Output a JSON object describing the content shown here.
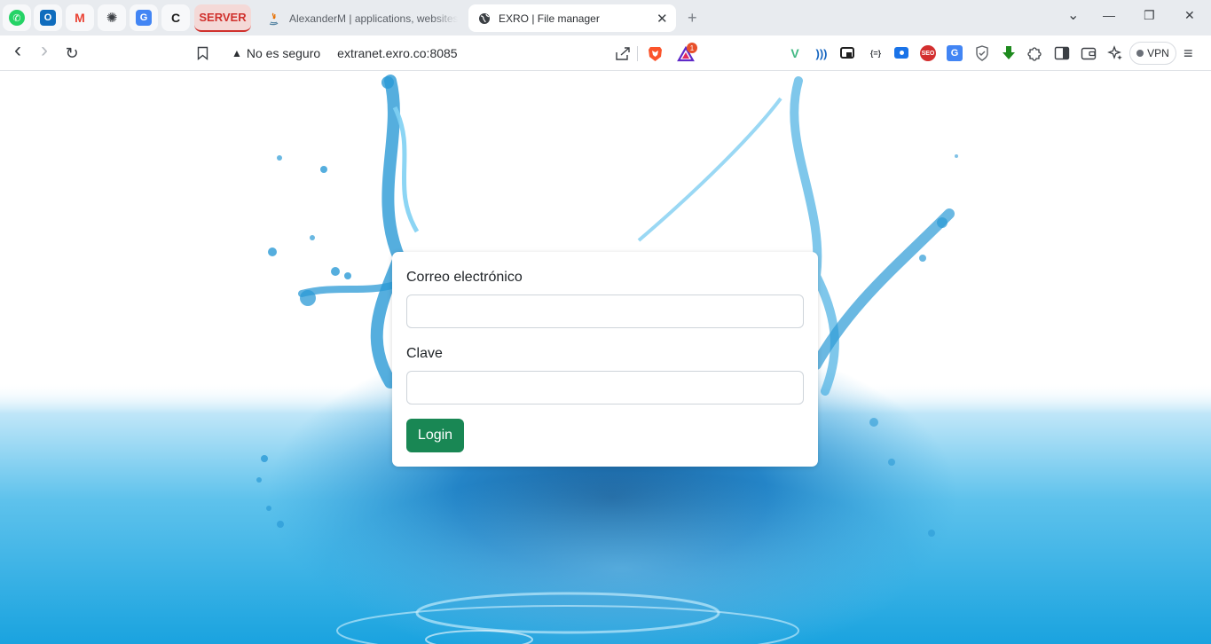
{
  "browser": {
    "pinned_tabs": [
      {
        "name": "whatsapp",
        "glyph": "✆",
        "color": "#25d366"
      },
      {
        "name": "outlook",
        "glyph": "O",
        "color": "#0f6cbd"
      },
      {
        "name": "gmail",
        "glyph": "M",
        "color": "#ea4335"
      },
      {
        "name": "chatgpt",
        "glyph": "✺",
        "color": "#3b3f44"
      },
      {
        "name": "google-translate",
        "glyph": "G",
        "color": "#4285f4"
      },
      {
        "name": "c-app",
        "glyph": "C",
        "color": "#1f1f1f"
      }
    ],
    "tabs": {
      "server_label": "SERVER",
      "inactive_title": "AlexanderM | applications, websites",
      "active_title": "EXRO | File manager",
      "close_glyph": "✕",
      "new_tab_glyph": "+"
    },
    "window_controls": {
      "dropdown": "⌄",
      "minimize": "—",
      "restore": "❐",
      "close": "✕"
    },
    "toolbar": {
      "back": "‹",
      "forward": "›",
      "reload": "↻",
      "security_text": "No es seguro",
      "url": "extranet.exro.co:8085",
      "shields_badge": "1",
      "vpn_label": "VPN",
      "menu": "≡"
    },
    "extension_icons": [
      "vue-devtools-icon",
      "wave-icon",
      "pip-icon",
      "json-viewer-icon",
      "screen-capture-icon",
      "seo-icon",
      "google-translate-icon",
      "privacy-shield-icon",
      "download-arrow-icon",
      "puzzle-extensions-icon",
      "sidebar-icon",
      "wallet-icon",
      "leo-ai-icon"
    ]
  },
  "login": {
    "email_label": "Correo electrónico",
    "email_value": "",
    "password_label": "Clave",
    "password_value": "",
    "submit_label": "Login",
    "submit_color": "#198754"
  }
}
